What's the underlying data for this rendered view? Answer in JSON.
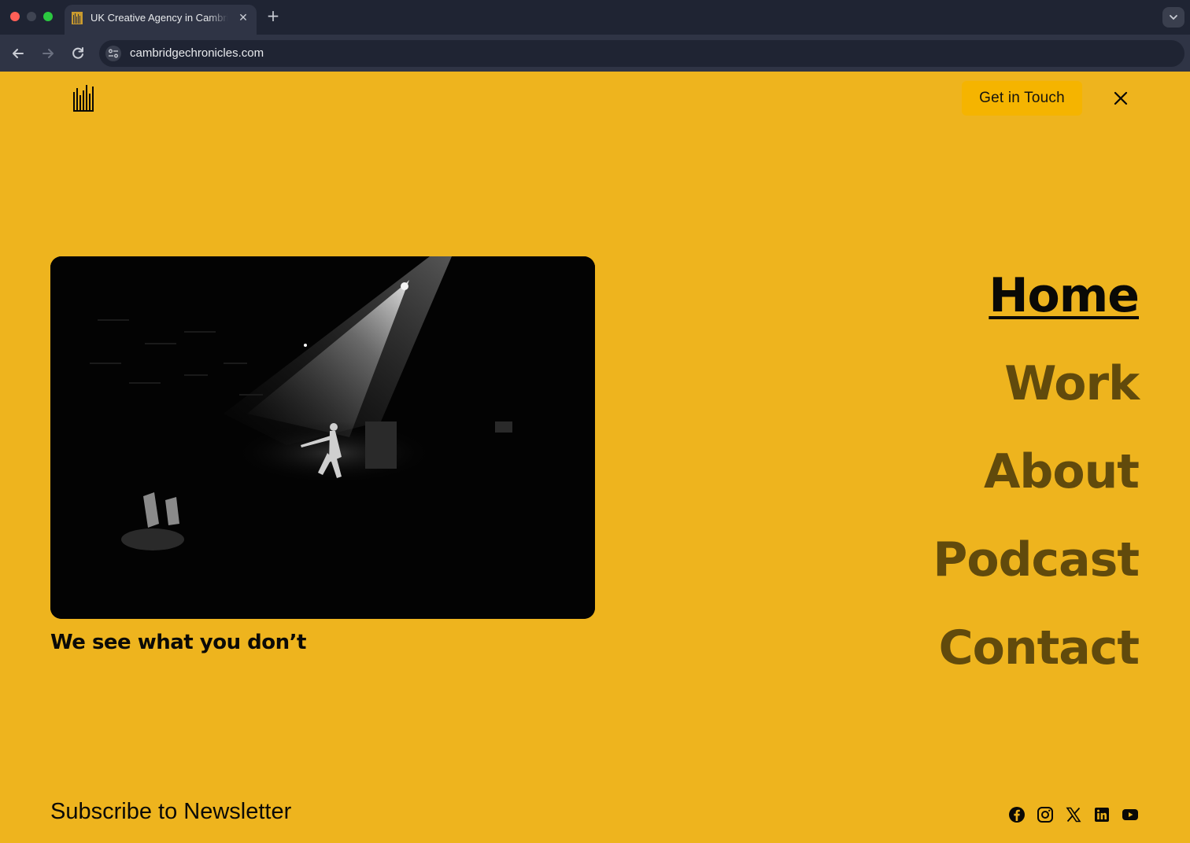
{
  "browser": {
    "tab_title": "UK Creative Agency in Cambridge",
    "url": "cambridgechronicles.com"
  },
  "header": {
    "cta_label": "Get in Touch"
  },
  "hero": {
    "tagline": "We see what you don’t"
  },
  "menu": {
    "items": [
      {
        "label": "Home",
        "active": true
      },
      {
        "label": "Work",
        "active": false
      },
      {
        "label": "About",
        "active": false
      },
      {
        "label": "Podcast",
        "active": false
      },
      {
        "label": "Contact",
        "active": false
      }
    ]
  },
  "footer": {
    "newsletter_label": "Subscribe to Newsletter",
    "socials": [
      "facebook-icon",
      "instagram-icon",
      "x-icon",
      "linkedin-icon",
      "youtube-icon"
    ]
  },
  "colors": {
    "background": "#EEB41E",
    "menu_inactive": "#614A0C",
    "menu_active": "#0A0906",
    "cta_background": "#F5B400",
    "browser_chrome": "#1F2433"
  }
}
